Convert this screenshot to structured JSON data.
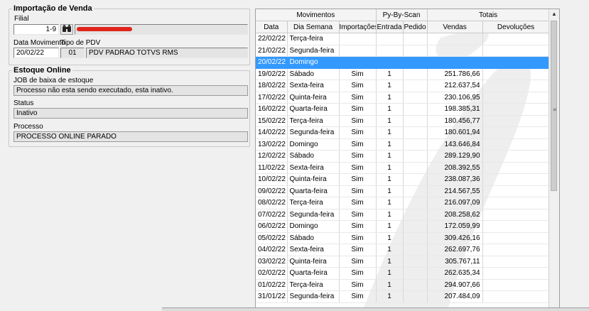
{
  "import_section": {
    "legend": "Importação de Venda",
    "filial_label": "Filial",
    "filial_value": "1-9",
    "data_mov_label": "Data Movimento",
    "tipo_pdv_label": "Tipo de PDV",
    "data_mov_value": "20/02/22",
    "tipo_pdv_code": "01",
    "tipo_pdv_desc": "PDV PADRAO TOTVS RMS"
  },
  "estoque_section": {
    "legend": "Estoque Online",
    "job_label": "JOB de baixa de estoque",
    "job_value": "Processo não esta sendo executado, esta inativo.",
    "status_label": "Status",
    "status_value": "Inativo",
    "processo_label": "Processo",
    "processo_value": "PROCESSO ONLINE PARADO"
  },
  "grid": {
    "group_headers": [
      "Movimentos",
      "Py-By-Scan",
      "Totais"
    ],
    "columns": [
      "Data",
      "Dia Semana",
      "Importações",
      "Entrada",
      "Pedido",
      "Vendas",
      "Devoluções"
    ],
    "selected_index": 2,
    "rows": [
      [
        "22/02/22",
        "Terça-feira",
        "",
        "",
        "",
        "",
        ""
      ],
      [
        "21/02/22",
        "Segunda-feira",
        "",
        "",
        "",
        "",
        ""
      ],
      [
        "20/02/22",
        "Domingo",
        "",
        "",
        "",
        "",
        ""
      ],
      [
        "19/02/22",
        "Sábado",
        "Sim",
        "1",
        "",
        "251.786,66",
        ""
      ],
      [
        "18/02/22",
        "Sexta-feira",
        "Sim",
        "1",
        "",
        "212.637,54",
        ""
      ],
      [
        "17/02/22",
        "Quinta-feira",
        "Sim",
        "1",
        "",
        "230.106,95",
        ""
      ],
      [
        "16/02/22",
        "Quarta-feira",
        "Sim",
        "1",
        "",
        "198.385,31",
        ""
      ],
      [
        "15/02/22",
        "Terça-feira",
        "Sim",
        "1",
        "",
        "180.456,77",
        ""
      ],
      [
        "14/02/22",
        "Segunda-feira",
        "Sim",
        "1",
        "",
        "180.601,94",
        ""
      ],
      [
        "13/02/22",
        "Domingo",
        "Sim",
        "1",
        "",
        "143.646,84",
        ""
      ],
      [
        "12/02/22",
        "Sábado",
        "Sim",
        "1",
        "",
        "289.129,90",
        ""
      ],
      [
        "11/02/22",
        "Sexta-feira",
        "Sim",
        "1",
        "",
        "208.392,55",
        ""
      ],
      [
        "10/02/22",
        "Quinta-feira",
        "Sim",
        "1",
        "",
        "238.087,36",
        ""
      ],
      [
        "09/02/22",
        "Quarta-feira",
        "Sim",
        "1",
        "",
        "214.567,55",
        ""
      ],
      [
        "08/02/22",
        "Terça-feira",
        "Sim",
        "1",
        "",
        "216.097,09",
        ""
      ],
      [
        "07/02/22",
        "Segunda-feira",
        "Sim",
        "1",
        "",
        "208.258,62",
        ""
      ],
      [
        "06/02/22",
        "Domingo",
        "Sim",
        "1",
        "",
        "172.059,99",
        ""
      ],
      [
        "05/02/22",
        "Sábado",
        "Sim",
        "1",
        "",
        "309.426,16",
        ""
      ],
      [
        "04/02/22",
        "Sexta-feira",
        "Sim",
        "1",
        "",
        "262.697,76",
        ""
      ],
      [
        "03/02/22",
        "Quinta-feira",
        "Sim",
        "1",
        "",
        "305.767,11",
        ""
      ],
      [
        "02/02/22",
        "Quarta-feira",
        "Sim",
        "1",
        "",
        "262.635,34",
        ""
      ],
      [
        "01/02/22",
        "Terça-feira",
        "Sim",
        "1",
        "",
        "294.907,66",
        ""
      ],
      [
        "31/01/22",
        "Segunda-feira",
        "Sim",
        "1",
        "",
        "207.484,09",
        ""
      ]
    ]
  },
  "colors": {
    "selection": "#3399ff",
    "redaction": "#e0231c"
  }
}
